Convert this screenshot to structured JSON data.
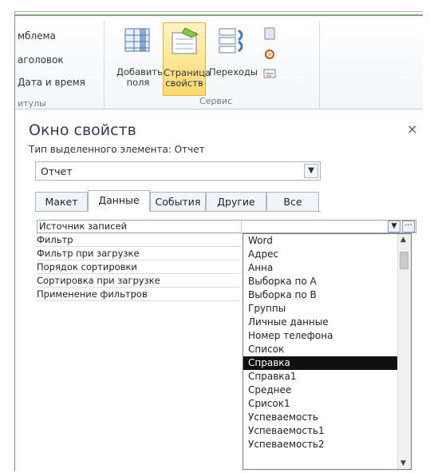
{
  "ribbon": {
    "left_items": [
      "мблема",
      "аголовок",
      "Дата и время",
      "итулы"
    ],
    "buttons": [
      {
        "label": "Добавить поля",
        "line1": "Добавить",
        "line2": "поля"
      },
      {
        "label": "Страница свойств",
        "line1": "Страница",
        "line2": "свойств"
      },
      {
        "label": "Переходы",
        "line1": "Переходы",
        "line2": ""
      }
    ],
    "group_label": "Сервис"
  },
  "pane": {
    "title": "Окно свойств",
    "close": "×",
    "selection_type": "Тип выделенного элемента:  Отчет",
    "object_combo_value": "Отчет",
    "tabs": [
      "Макет",
      "Данные",
      "События",
      "Другие",
      "Все"
    ],
    "active_tab": "Данные"
  },
  "properties": [
    "Источник записей",
    "Фильтр",
    "Фильтр при загрузке",
    "Порядок сортировки",
    "Сортировка при загрузке",
    "Применение фильтров"
  ],
  "dropdown": {
    "items": [
      "Word",
      "Адрес",
      "Анна",
      "Выборка по А",
      "Выборка по В",
      "Группы",
      "Личные данные",
      "Номер телефона",
      "Список",
      "Справка",
      "Справка1",
      "Среднее",
      "Срисок1",
      "Успеваемость",
      "Успеваемость1",
      "Успеваемость2"
    ],
    "selected": "Справка"
  },
  "icons": {
    "dropdown_arrow": "chevron-down-icon",
    "build": "ellipsis-icon"
  },
  "colors": {
    "active_button": "#fbd96c",
    "selected_item": "#111111",
    "title": "#2e3d55"
  }
}
